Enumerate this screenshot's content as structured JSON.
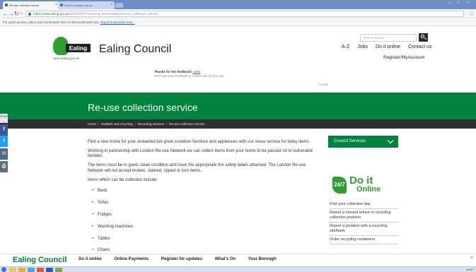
{
  "browser": {
    "tabs": [
      {
        "label": "Re-use collection servic",
        "active": true
      },
      {
        "label": "How to connect my se...",
        "active": false
      }
    ],
    "url_protocol": "https://",
    "url_host": "www.ealing.gov.uk",
    "url_path": "/info/201077/recycling_services/2812/re-use_collection_service",
    "bookmarks_text": "For quick access, place your bookmarks here on the bookmarks bar.",
    "bookmarks_link": "Import bookmarks now..."
  },
  "header": {
    "search_placeholder": "Search website",
    "logo_word": "Ealing",
    "logo_url": "www.ealing.gov.uk",
    "site_title": "Ealing Council",
    "top_links": [
      "A-Z",
      "Jobs",
      "Do it online",
      "Contact us"
    ],
    "account_link": "Register/MyAccount"
  },
  "feedback": {
    "title": "Thanks for the feedback!",
    "undo": "Undo",
    "sub": "We'll use your feedback to review ads on this site.",
    "google": "Google"
  },
  "banner": {
    "page_title": "Re-use collection service",
    "breadcrumbs": [
      "Home",
      "Rubbish and recycling",
      "Recycling services",
      "Re-use collection service"
    ]
  },
  "share": {
    "label": "Share"
  },
  "content": {
    "paragraphs": [
      "Find a new home for your unwanted but good condition furniture and appliances with our reuse service for bulky items.",
      "Working in partnership with London Re-use Network we can collect items from your home to be passed on to vulnerable families.",
      "The items must be in good, clean condition and have the appropriate fire safety labels attached. The London Re-use Network will not accept broken, stained, ripped or torn items.",
      "Items which can be collected include:"
    ],
    "items": [
      "Beds",
      "Sofas",
      "Fridges",
      "Washing machines",
      "Tables",
      "Chairs"
    ]
  },
  "sidebar": {
    "services_label": "Council Services",
    "doit_badge": "24/7",
    "doit_title": "Do it",
    "doit_sub": "Online",
    "links": [
      "Find your collection day",
      "Report a missed refuse or recycling collection problem",
      "Report a problem with a recycling site/bank",
      "Order recycling containers"
    ]
  },
  "footer": {
    "brand": "Ealing Council",
    "links": [
      "Do it online",
      "Online Payments",
      "Register for updates",
      "What's On",
      "Your Borough"
    ]
  },
  "taskbar": {
    "clock": "10:47"
  },
  "colors": {
    "brand_green": "#00833e",
    "breadcrumb_bar": "#2f2f2f",
    "chrome_blue": "#6d8fc6"
  }
}
